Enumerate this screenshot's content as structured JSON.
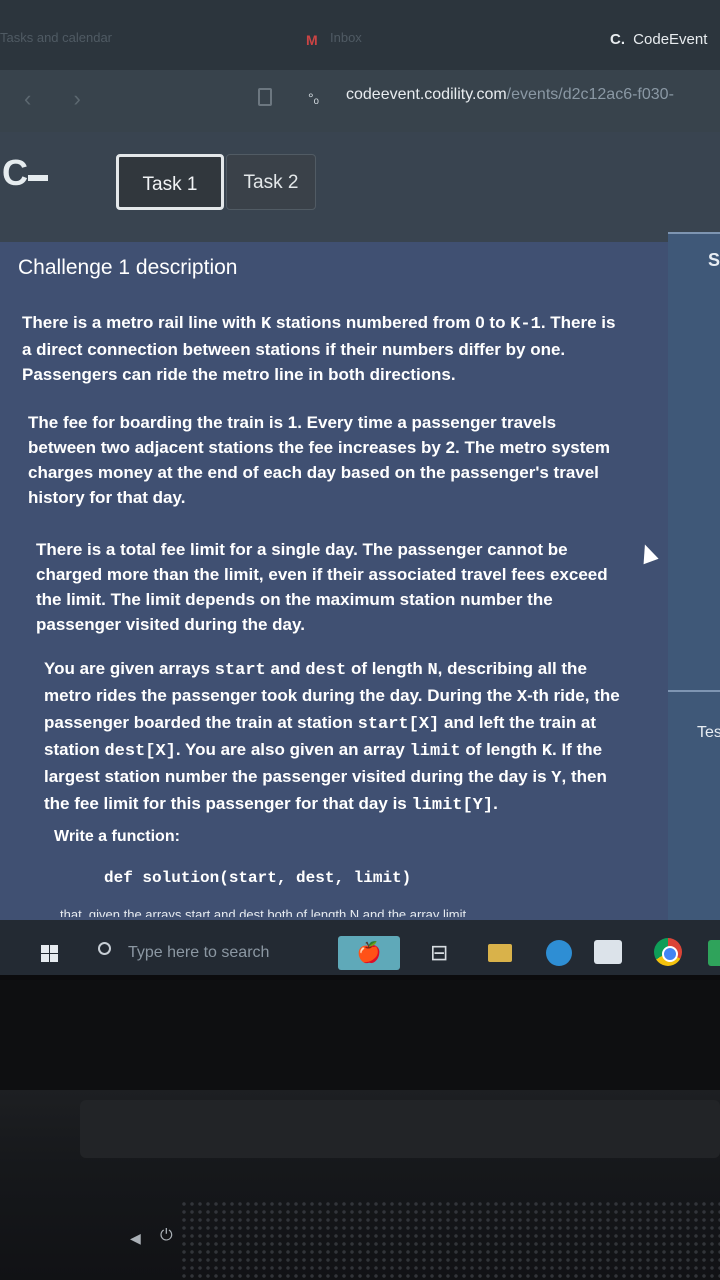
{
  "browser": {
    "faded_tab_left": "Tasks and calendar",
    "faded_tab_middle": "Inbox",
    "active_tab": {
      "logo": "C.",
      "title": "CodeEvent"
    },
    "url_host": "codeevent.codility.com",
    "url_path": "/events/d2c12ac6-f030-"
  },
  "app": {
    "logo": "C",
    "tabs": [
      {
        "label": "Task 1",
        "active": true
      },
      {
        "label": "Task 2",
        "active": false
      }
    ],
    "side_letter": "S",
    "side_test_label": "Tes"
  },
  "challenge": {
    "title": "Challenge 1 description",
    "p1": [
      "There is a metro rail line with ",
      "K",
      " stations numbered from 0 to ",
      "K-1",
      ". There is a direct connection between stations if their numbers differ by one. Passengers can ride the metro line in both directions."
    ],
    "p2": "The fee for boarding the train is 1. Every time a passenger travels between two adjacent stations the fee increases by 2. The metro system charges money at the end of each day based on the passenger's travel history for that day.",
    "p3": "There is a total fee limit for a single day. The passenger cannot be charged more than the limit, even if their associated travel fees exceed the limit. The limit depends on the maximum station number the passenger visited during the day.",
    "p4": [
      "You are given arrays ",
      "start",
      " and ",
      "dest",
      " of length ",
      "N",
      ", describing all the metro rides the passenger took during the day. During the ",
      "X",
      "-th ride, the passenger boarded the train at station ",
      "start[X]",
      " and left the train at station ",
      "dest[X]",
      ". You are also given an array ",
      "limit",
      " of length ",
      "K",
      ". If the largest station number the passenger visited during the day is ",
      "Y",
      ", then the fee limit for this passenger for that day is ",
      "limit[Y]",
      "."
    ],
    "write_function": "Write a function:",
    "signature": "def solution(start, dest, limit)",
    "cut_line": "that, given the arrays start and dest both of length N and the array limit"
  },
  "taskbar": {
    "search_placeholder": "Type here to search",
    "icons": [
      "windows-start-icon",
      "search-icon",
      "apple-app-icon",
      "task-view-icon",
      "file-explorer-icon",
      "edge-icon",
      "store-icon",
      "chrome-icon",
      "green-app-icon"
    ]
  }
}
